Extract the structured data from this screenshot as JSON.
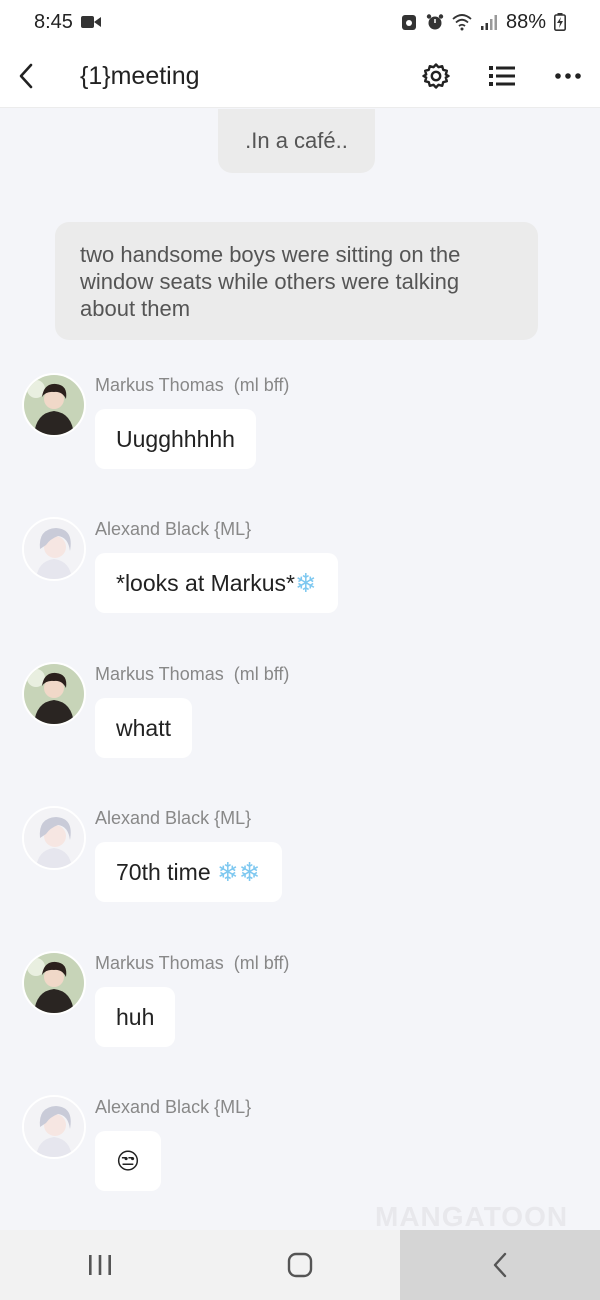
{
  "status_bar": {
    "time": "8:45",
    "battery": "88%"
  },
  "header": {
    "title": "{1}meeting"
  },
  "narration": [
    ".In a café..",
    "two handsome boys were sitting on the window seats while others were talking about them"
  ],
  "messages": [
    {
      "sender": "Markus Thomas  (ml bff)",
      "text": "Uugghhhhh",
      "emoji": ""
    },
    {
      "sender": "Alexand Black {ML}",
      "text": "*looks at Markus*",
      "emoji": "❄"
    },
    {
      "sender": "Markus Thomas  (ml bff)",
      "text": "whatt",
      "emoji": ""
    },
    {
      "sender": "Alexand Black {ML}",
      "text": "70th time ",
      "emoji": "❄❄"
    },
    {
      "sender": "Markus Thomas  (ml bff)",
      "text": "huh",
      "emoji": ""
    },
    {
      "sender": "Alexand Black {ML}",
      "text": "😒",
      "emoji": ""
    }
  ],
  "watermark": "MANGATOON",
  "colors": {
    "background": "#f4f5f9",
    "bubble": "#ffffff",
    "narration": "#ebebeb",
    "snow": "#7ec8f0"
  }
}
